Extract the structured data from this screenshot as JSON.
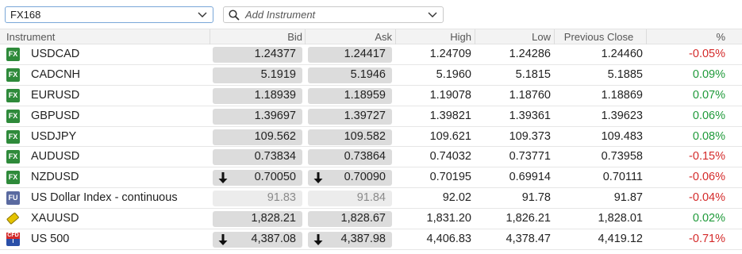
{
  "toolbar": {
    "source_value": "FX168",
    "search_placeholder": "Add Instrument"
  },
  "columns": [
    "Instrument",
    "Bid",
    "Ask",
    "High",
    "Low",
    "Previous Close",
    "%"
  ],
  "rows": [
    {
      "badge": "FX",
      "type": "fx",
      "name": "USDCAD",
      "bid": "1.24377",
      "ask": "1.24417",
      "high": "1.24709",
      "low": "1.24286",
      "prev": "1.24460",
      "pct": "-0.05%",
      "dir": "neg",
      "arrow": false,
      "dim": false
    },
    {
      "badge": "FX",
      "type": "fx",
      "name": "CADCNH",
      "bid": "5.1919",
      "ask": "5.1946",
      "high": "5.1960",
      "low": "5.1815",
      "prev": "5.1885",
      "pct": "0.09%",
      "dir": "pos",
      "arrow": false,
      "dim": false
    },
    {
      "badge": "FX",
      "type": "fx",
      "name": "EURUSD",
      "bid": "1.18939",
      "ask": "1.18959",
      "high": "1.19078",
      "low": "1.18760",
      "prev": "1.18869",
      "pct": "0.07%",
      "dir": "pos",
      "arrow": false,
      "dim": false
    },
    {
      "badge": "FX",
      "type": "fx",
      "name": "GBPUSD",
      "bid": "1.39697",
      "ask": "1.39727",
      "high": "1.39821",
      "low": "1.39361",
      "prev": "1.39623",
      "pct": "0.06%",
      "dir": "pos",
      "arrow": false,
      "dim": false
    },
    {
      "badge": "FX",
      "type": "fx",
      "name": "USDJPY",
      "bid": "109.562",
      "ask": "109.582",
      "high": "109.621",
      "low": "109.373",
      "prev": "109.483",
      "pct": "0.08%",
      "dir": "pos",
      "arrow": false,
      "dim": false
    },
    {
      "badge": "FX",
      "type": "fx",
      "name": "AUDUSD",
      "bid": "0.73834",
      "ask": "0.73864",
      "high": "0.74032",
      "low": "0.73771",
      "prev": "0.73958",
      "pct": "-0.15%",
      "dir": "neg",
      "arrow": false,
      "dim": false
    },
    {
      "badge": "FX",
      "type": "fx",
      "name": "NZDUSD",
      "bid": "0.70050",
      "ask": "0.70090",
      "high": "0.70195",
      "low": "0.69914",
      "prev": "0.70111",
      "pct": "-0.06%",
      "dir": "neg",
      "arrow": true,
      "dim": false
    },
    {
      "badge": "FU",
      "type": "fu",
      "name": "US Dollar Index - continuous",
      "bid": "91.83",
      "ask": "91.84",
      "high": "92.02",
      "low": "91.78",
      "prev": "91.87",
      "pct": "-0.04%",
      "dir": "neg",
      "arrow": false,
      "dim": true
    },
    {
      "badge": "",
      "type": "cmd",
      "name": "XAUUSD",
      "bid": "1,828.21",
      "ask": "1,828.67",
      "high": "1,831.20",
      "low": "1,826.21",
      "prev": "1,828.01",
      "pct": "0.02%",
      "dir": "pos",
      "arrow": false,
      "dim": false
    },
    {
      "badge": "CFD",
      "type": "cfd",
      "name": "US 500",
      "bid": "4,387.08",
      "ask": "4,387.98",
      "high": "4,406.83",
      "low": "4,378.47",
      "prev": "4,419.12",
      "pct": "-0.71%",
      "dir": "neg",
      "arrow": true,
      "dim": false
    }
  ],
  "colors": {
    "negative": "#d42a2a",
    "positive": "#1f9a3a",
    "fx_badge": "#2e8a3a"
  }
}
